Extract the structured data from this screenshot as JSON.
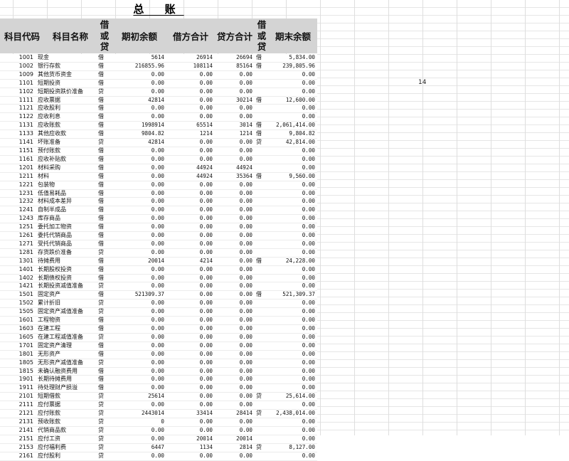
{
  "title": "总 账",
  "header": {
    "code": "科目代码",
    "name": "科目名称",
    "dir1_chars": [
      "借",
      "或",
      "贷"
    ],
    "opening": "期初余额",
    "debit": "借方合计",
    "credit": "贷方合计",
    "dir2_chars": [
      "借",
      "或",
      "贷"
    ],
    "closing": "期末余额"
  },
  "side_value": "14",
  "rows": [
    [
      "1001",
      "现金",
      "借",
      "5614",
      "26914",
      "26694",
      "借",
      "5,834.00"
    ],
    [
      "1002",
      "银行存款",
      "借",
      "216855.96",
      "108114",
      "85164",
      "借",
      "239,805.96"
    ],
    [
      "1009",
      "其他货币资金",
      "借",
      "0.00",
      "0.00",
      "0.00",
      "",
      "0.00"
    ],
    [
      "1101",
      "短期投资",
      "借",
      "0.00",
      "0.00",
      "0.00",
      "",
      "0.00"
    ],
    [
      "1102",
      "短期投资跌价准备",
      "贷",
      "0.00",
      "0.00",
      "0.00",
      "",
      "0.00"
    ],
    [
      "1111",
      "应收票据",
      "借",
      "42814",
      "0.00",
      "30214",
      "借",
      "12,600.00"
    ],
    [
      "1121",
      "应收股利",
      "借",
      "0.00",
      "0.00",
      "0.00",
      "",
      "0.00"
    ],
    [
      "1122",
      "应收利息",
      "借",
      "0.00",
      "0.00",
      "0.00",
      "",
      "0.00"
    ],
    [
      "1131",
      "应收账款",
      "借",
      "1998914",
      "65514",
      "3014",
      "借",
      "2,061,414.00"
    ],
    [
      "1133",
      "其他应收款",
      "借",
      "9804.82",
      "1214",
      "1214",
      "借",
      "9,804.82"
    ],
    [
      "1141",
      "坏账准备",
      "贷",
      "42814",
      "0.00",
      "0.00",
      "贷",
      "42,814.00"
    ],
    [
      "1151",
      "预付账款",
      "借",
      "0.00",
      "0.00",
      "0.00",
      "",
      "0.00"
    ],
    [
      "1161",
      "应收补贴款",
      "借",
      "0.00",
      "0.00",
      "0.00",
      "",
      "0.00"
    ],
    [
      "1201",
      "材料采购",
      "借",
      "0.00",
      "44924",
      "44924",
      "",
      "0.00"
    ],
    [
      "1211",
      "材料",
      "借",
      "0.00",
      "44924",
      "35364",
      "借",
      "9,560.00"
    ],
    [
      "1221",
      "包装物",
      "借",
      "0.00",
      "0.00",
      "0.00",
      "",
      "0.00"
    ],
    [
      "1231",
      "低值易耗品",
      "借",
      "0.00",
      "0.00",
      "0.00",
      "",
      "0.00"
    ],
    [
      "1232",
      "材料成本差异",
      "借",
      "0.00",
      "0.00",
      "0.00",
      "",
      "0.00"
    ],
    [
      "1241",
      "自制半成品",
      "借",
      "0.00",
      "0.00",
      "0.00",
      "",
      "0.00"
    ],
    [
      "1243",
      "库存商品",
      "借",
      "0.00",
      "0.00",
      "0.00",
      "",
      "0.00"
    ],
    [
      "1251",
      "委托加工物资",
      "借",
      "0.00",
      "0.00",
      "0.00",
      "",
      "0.00"
    ],
    [
      "1261",
      "委托代销商品",
      "借",
      "0.00",
      "0.00",
      "0.00",
      "",
      "0.00"
    ],
    [
      "1271",
      "受托代销商品",
      "借",
      "0.00",
      "0.00",
      "0.00",
      "",
      "0.00"
    ],
    [
      "1281",
      "存货跌价准备",
      "贷",
      "0.00",
      "0.00",
      "0.00",
      "",
      "0.00"
    ],
    [
      "1301",
      "待摊费用",
      "借",
      "20014",
      "4214",
      "0.00",
      "借",
      "24,228.00"
    ],
    [
      "1401",
      "长期股权投资",
      "借",
      "0.00",
      "0.00",
      "0.00",
      "",
      "0.00"
    ],
    [
      "1402",
      "长期债权投资",
      "借",
      "0.00",
      "0.00",
      "0.00",
      "",
      "0.00"
    ],
    [
      "1421",
      "长期投资减值准备",
      "贷",
      "0.00",
      "0.00",
      "0.00",
      "",
      "0.00"
    ],
    [
      "1501",
      "固定资产",
      "借",
      "521309.37",
      "0.00",
      "0.00",
      "借",
      "521,309.37"
    ],
    [
      "1502",
      "累计折旧",
      "贷",
      "0.00",
      "0.00",
      "0.00",
      "",
      "0.00"
    ],
    [
      "1505",
      "固定资产减值准备",
      "贷",
      "0.00",
      "0.00",
      "0.00",
      "",
      "0.00"
    ],
    [
      "1601",
      "工程物资",
      "借",
      "0.00",
      "0.00",
      "0.00",
      "",
      "0.00"
    ],
    [
      "1603",
      "在建工程",
      "借",
      "0.00",
      "0.00",
      "0.00",
      "",
      "0.00"
    ],
    [
      "1605",
      "在建工程减值准备",
      "贷",
      "0.00",
      "0.00",
      "0.00",
      "",
      "0.00"
    ],
    [
      "1701",
      "固定资产清理",
      "借",
      "0.00",
      "0.00",
      "0.00",
      "",
      "0.00"
    ],
    [
      "1801",
      "无形资产",
      "借",
      "0.00",
      "0.00",
      "0.00",
      "",
      "0.00"
    ],
    [
      "1805",
      "无形资产减值准备",
      "贷",
      "0.00",
      "0.00",
      "0.00",
      "",
      "0.00"
    ],
    [
      "1815",
      "未确认融资费用",
      "借",
      "0.00",
      "0.00",
      "0.00",
      "",
      "0.00"
    ],
    [
      "1901",
      "长期待摊费用",
      "借",
      "0.00",
      "0.00",
      "0.00",
      "",
      "0.00"
    ],
    [
      "1911",
      "待处理财产损溢",
      "借",
      "0.00",
      "0.00",
      "0.00",
      "",
      "0.00"
    ],
    [
      "2101",
      "短期借款",
      "贷",
      "25614",
      "0.00",
      "0.00",
      "贷",
      "25,614.00"
    ],
    [
      "2111",
      "应付票据",
      "贷",
      "0.00",
      "0.00",
      "0.00",
      "",
      "0.00"
    ],
    [
      "2121",
      "应付账款",
      "贷",
      "2443014",
      "33414",
      "28414",
      "贷",
      "2,438,014.00"
    ],
    [
      "2131",
      "预收账款",
      "贷",
      "0",
      "0.00",
      "0.00",
      "",
      "0.00"
    ],
    [
      "2141",
      "代销商品款",
      "贷",
      "0.00",
      "0.00",
      "0.00",
      "",
      "0.00"
    ],
    [
      "2151",
      "应付工资",
      "贷",
      "0.00",
      "20014",
      "20014",
      "",
      "0.00"
    ],
    [
      "2153",
      "应付福利费",
      "贷",
      "6447",
      "1134",
      "2814",
      "贷",
      "8,127.00"
    ],
    [
      "2161",
      "应付股利",
      "贷",
      "0.00",
      "0.00",
      "0.00",
      "",
      "0.00"
    ]
  ]
}
